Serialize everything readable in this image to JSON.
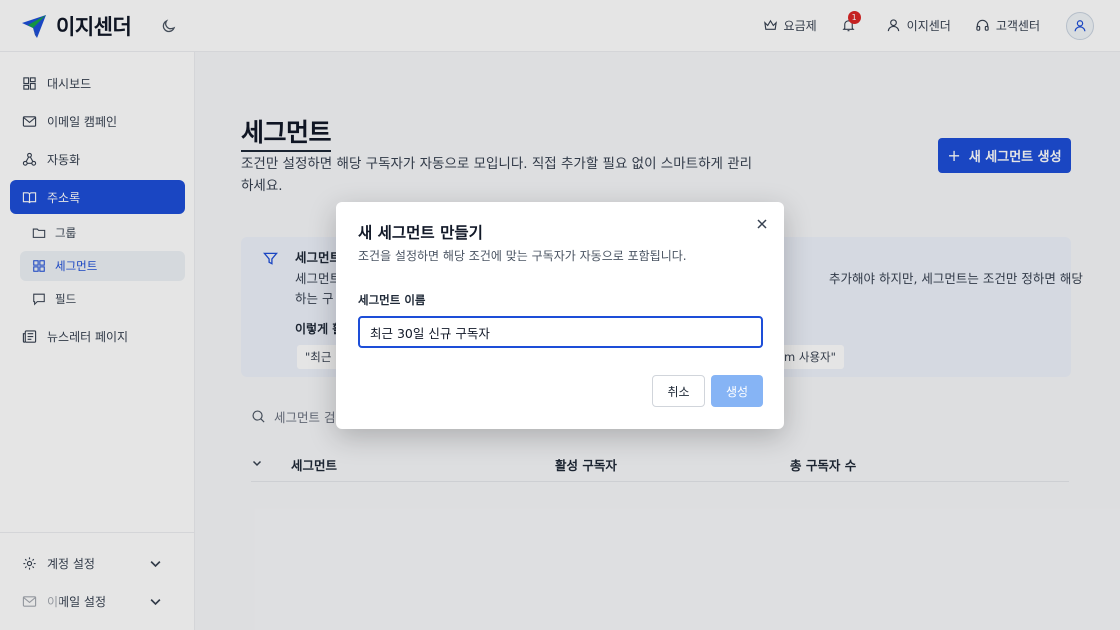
{
  "app": {
    "name": "이지센더",
    "accent": "#1d4ed8"
  },
  "header": {
    "items": [
      {
        "label": "요금제",
        "icon": "crown-icon"
      },
      {
        "label": "",
        "icon": "bell-icon",
        "badge": "1"
      },
      {
        "label": "이지센더",
        "icon": "user-icon"
      },
      {
        "label": "고객센터",
        "icon": "headset-icon"
      }
    ]
  },
  "sidebar": {
    "items": [
      {
        "label": "대시보드",
        "icon": "dashboard-icon"
      },
      {
        "label": "이메일 캠페인",
        "icon": "mail-icon"
      },
      {
        "label": "자동화",
        "icon": "automation-icon"
      },
      {
        "label": "주소록",
        "icon": "book-icon",
        "active": true
      },
      {
        "label": "뉴스레터 페이지",
        "icon": "newspaper-icon"
      }
    ],
    "sub_items": [
      {
        "label": "그룹",
        "icon": "folder-icon"
      },
      {
        "label": "세그먼트",
        "icon": "grid-icon",
        "active": true
      },
      {
        "label": "필드",
        "icon": "message-icon"
      }
    ],
    "bottom": [
      {
        "label": "계정 설정",
        "icon": "gear-icon"
      },
      {
        "label": "이메일 설정",
        "icon": "mail-settings-icon"
      }
    ]
  },
  "main": {
    "title": "세그먼트",
    "description": "조건만 설정하면 해당 구독자가 자동으로 모입니다. 직접 추가할 필요 없이 스마트하게 관리하세요.",
    "new_button": "새 세그먼트 생성",
    "info": {
      "title": "세그먼트",
      "text": "세그먼트 추가해야 하지만, 세그먼트는 조건만 정하면 해당 하는 구",
      "text_left_line1": "세그먼트",
      "text_left_line2": "하는 구",
      "text_right_line1": "추가해야 하지만, 세그먼트는 조건만 정하면 해당",
      "subtitle": "이렇게 활",
      "example_left": "\"최근 3",
      "example_right": "om 사용자\""
    },
    "search_placeholder": "세그먼트 검색",
    "table": {
      "columns": [
        "세그먼트",
        "활성 구독자",
        "총 구독자 수"
      ]
    }
  },
  "modal": {
    "title": "새 세그먼트 만들기",
    "description": "조건을 설정하면 해당 조건에 맞는 구독자가 자동으로 포함됩니다.",
    "field_label": "세그먼트 이름",
    "field_value": "최근 30일 신규 구독자",
    "cancel_label": "취소",
    "create_label": "생성"
  }
}
